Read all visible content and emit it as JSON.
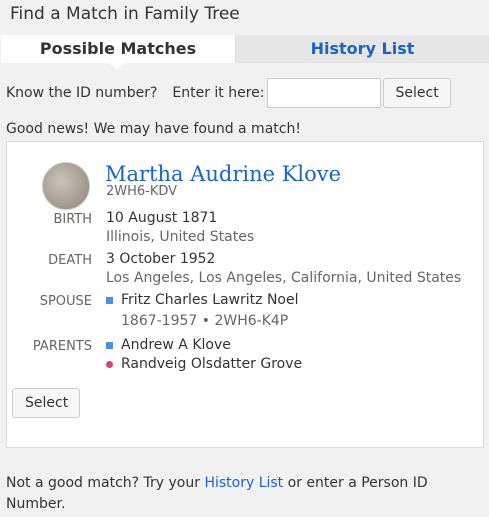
{
  "header": {
    "title": "Find a Match in Family Tree"
  },
  "tabs": [
    {
      "label": "Possible Matches",
      "active": true
    },
    {
      "label": "History List",
      "active": false
    }
  ],
  "id_lookup": {
    "question": "Know the ID number?",
    "prompt": "Enter it here:",
    "input_value": "",
    "input_placeholder": "",
    "select_label": "Select"
  },
  "status_text": "Good news! We may have found a match!",
  "match": {
    "name": "Martha Audrine Klove",
    "person_id": "2WH6-KDV",
    "birth": {
      "label": "BIRTH",
      "date": "10 August 1871",
      "place": "Illinois, United States"
    },
    "death": {
      "label": "DEATH",
      "date": "3 October 1952",
      "place": "Los Angeles, Los Angeles, California, United States"
    },
    "spouse": {
      "label": "SPOUSE",
      "name": "Fritz Charles Lawritz Noel",
      "details": "1867-1957 • 2WH6-K4P"
    },
    "parents": {
      "label": "PARENTS",
      "father": "Andrew A Klove",
      "mother": "Randveig Olsdatter Grove"
    },
    "select_label": "Select"
  },
  "footer": {
    "before_link": "Not a good match? Try your ",
    "link": "History List",
    "after_link": " or enter a Person ID Number."
  },
  "colors": {
    "link": "#1a64c7",
    "male": "#4a90e2",
    "female": "#d6407a"
  }
}
